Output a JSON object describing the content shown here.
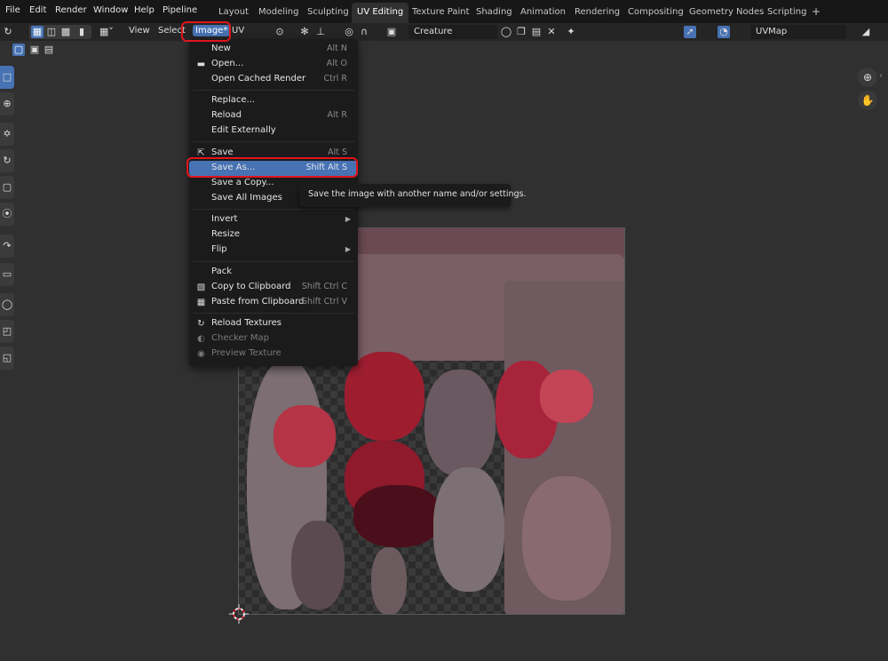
{
  "top_menu": [
    "File",
    "Edit",
    "Render",
    "Window",
    "Help",
    "Pipeline"
  ],
  "workspaces": [
    "Layout",
    "Modeling",
    "Sculpting",
    "UV Editing",
    "Texture Paint",
    "Shading",
    "Animation",
    "Rendering",
    "Compositing",
    "Geometry Nodes",
    "Scripting"
  ],
  "add_workspace": "+",
  "header": {
    "view": "View",
    "select": "Select",
    "image": "Image*",
    "uv": "UV",
    "image_name": "Creature",
    "uv_map": "UVMap"
  },
  "image_menu": {
    "items": [
      {
        "label": "New",
        "shortcut": "Alt N"
      },
      {
        "label": "Open...",
        "shortcut": "Alt O",
        "icon": "folder-icon"
      },
      {
        "label": "Open Cached Render",
        "shortcut": "Ctrl R"
      },
      {
        "label": "Replace...",
        "shortcut": ""
      },
      {
        "label": "Reload",
        "shortcut": "Alt R"
      },
      {
        "label": "Edit Externally",
        "shortcut": ""
      },
      {
        "label": "Save",
        "shortcut": "Alt S",
        "icon": "save-icon"
      },
      {
        "label": "Save As...",
        "shortcut": "Shift Alt S"
      },
      {
        "label": "Save a Copy...",
        "shortcut": ""
      },
      {
        "label": "Save All Images",
        "shortcut": ""
      },
      {
        "label": "Invert",
        "shortcut": ""
      },
      {
        "label": "Resize",
        "shortcut": ""
      },
      {
        "label": "Flip",
        "shortcut": ""
      },
      {
        "label": "Pack",
        "shortcut": ""
      },
      {
        "label": "Copy to Clipboard",
        "shortcut": "Shift Ctrl C",
        "icon": "copy-icon"
      },
      {
        "label": "Paste from Clipboard",
        "shortcut": "Shift Ctrl V",
        "icon": "paste-icon"
      },
      {
        "label": "Reload Textures",
        "shortcut": "",
        "icon": "reload-icon"
      },
      {
        "label": "Checker Map",
        "shortcut": "",
        "icon": "checker-icon"
      },
      {
        "label": "Preview Texture",
        "shortcut": "",
        "icon": "eye-icon"
      }
    ]
  },
  "tooltip": "Save the image with another name and/or settings.",
  "colors": {
    "accent": "#4772b3",
    "highlight_box": "#e0151b",
    "menu_bg": "#1b1b1b",
    "viewport_bg": "#303030"
  }
}
